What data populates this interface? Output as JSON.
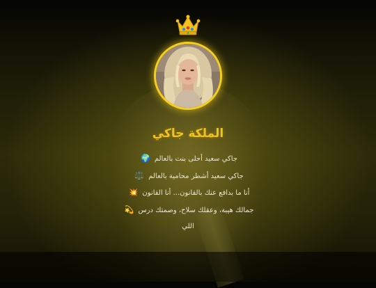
{
  "profile": {
    "crown_icon": "👑",
    "avatar": "profile-photo",
    "name": "الملكة جاكي",
    "accent_color": "#f2c21a",
    "bio": [
      {
        "text": "جاكي سعيد أحلى بنت بالعالم",
        "emoji": "🌍"
      },
      {
        "text": "جاكي سعيد أشطر محامية بالعالم",
        "emoji": "⚖️"
      },
      {
        "text": "أنا ما بدافع عنك بالقانون... أنا القانون",
        "emoji": "💥"
      },
      {
        "text": "جمالك هيبة، وعقلك سلاح، وصمتك درس",
        "emoji": "💫"
      },
      {
        "text": "اللي",
        "emoji": ""
      }
    ]
  }
}
